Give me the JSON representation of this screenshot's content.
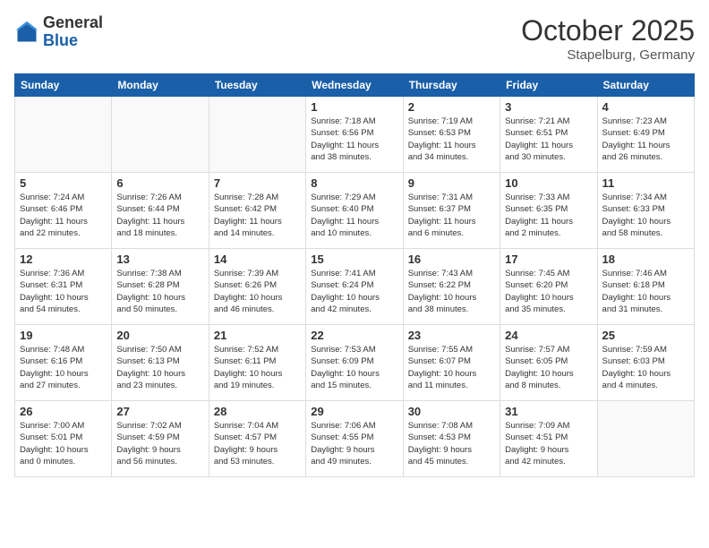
{
  "header": {
    "logo": {
      "general": "General",
      "blue": "Blue"
    },
    "month": "October 2025",
    "location": "Stapelburg, Germany"
  },
  "weekdays": [
    "Sunday",
    "Monday",
    "Tuesday",
    "Wednesday",
    "Thursday",
    "Friday",
    "Saturday"
  ],
  "weeks": [
    [
      {
        "day": "",
        "info": ""
      },
      {
        "day": "",
        "info": ""
      },
      {
        "day": "",
        "info": ""
      },
      {
        "day": "1",
        "info": "Sunrise: 7:18 AM\nSunset: 6:56 PM\nDaylight: 11 hours\nand 38 minutes."
      },
      {
        "day": "2",
        "info": "Sunrise: 7:19 AM\nSunset: 6:53 PM\nDaylight: 11 hours\nand 34 minutes."
      },
      {
        "day": "3",
        "info": "Sunrise: 7:21 AM\nSunset: 6:51 PM\nDaylight: 11 hours\nand 30 minutes."
      },
      {
        "day": "4",
        "info": "Sunrise: 7:23 AM\nSunset: 6:49 PM\nDaylight: 11 hours\nand 26 minutes."
      }
    ],
    [
      {
        "day": "5",
        "info": "Sunrise: 7:24 AM\nSunset: 6:46 PM\nDaylight: 11 hours\nand 22 minutes."
      },
      {
        "day": "6",
        "info": "Sunrise: 7:26 AM\nSunset: 6:44 PM\nDaylight: 11 hours\nand 18 minutes."
      },
      {
        "day": "7",
        "info": "Sunrise: 7:28 AM\nSunset: 6:42 PM\nDaylight: 11 hours\nand 14 minutes."
      },
      {
        "day": "8",
        "info": "Sunrise: 7:29 AM\nSunset: 6:40 PM\nDaylight: 11 hours\nand 10 minutes."
      },
      {
        "day": "9",
        "info": "Sunrise: 7:31 AM\nSunset: 6:37 PM\nDaylight: 11 hours\nand 6 minutes."
      },
      {
        "day": "10",
        "info": "Sunrise: 7:33 AM\nSunset: 6:35 PM\nDaylight: 11 hours\nand 2 minutes."
      },
      {
        "day": "11",
        "info": "Sunrise: 7:34 AM\nSunset: 6:33 PM\nDaylight: 10 hours\nand 58 minutes."
      }
    ],
    [
      {
        "day": "12",
        "info": "Sunrise: 7:36 AM\nSunset: 6:31 PM\nDaylight: 10 hours\nand 54 minutes."
      },
      {
        "day": "13",
        "info": "Sunrise: 7:38 AM\nSunset: 6:28 PM\nDaylight: 10 hours\nand 50 minutes."
      },
      {
        "day": "14",
        "info": "Sunrise: 7:39 AM\nSunset: 6:26 PM\nDaylight: 10 hours\nand 46 minutes."
      },
      {
        "day": "15",
        "info": "Sunrise: 7:41 AM\nSunset: 6:24 PM\nDaylight: 10 hours\nand 42 minutes."
      },
      {
        "day": "16",
        "info": "Sunrise: 7:43 AM\nSunset: 6:22 PM\nDaylight: 10 hours\nand 38 minutes."
      },
      {
        "day": "17",
        "info": "Sunrise: 7:45 AM\nSunset: 6:20 PM\nDaylight: 10 hours\nand 35 minutes."
      },
      {
        "day": "18",
        "info": "Sunrise: 7:46 AM\nSunset: 6:18 PM\nDaylight: 10 hours\nand 31 minutes."
      }
    ],
    [
      {
        "day": "19",
        "info": "Sunrise: 7:48 AM\nSunset: 6:16 PM\nDaylight: 10 hours\nand 27 minutes."
      },
      {
        "day": "20",
        "info": "Sunrise: 7:50 AM\nSunset: 6:13 PM\nDaylight: 10 hours\nand 23 minutes."
      },
      {
        "day": "21",
        "info": "Sunrise: 7:52 AM\nSunset: 6:11 PM\nDaylight: 10 hours\nand 19 minutes."
      },
      {
        "day": "22",
        "info": "Sunrise: 7:53 AM\nSunset: 6:09 PM\nDaylight: 10 hours\nand 15 minutes."
      },
      {
        "day": "23",
        "info": "Sunrise: 7:55 AM\nSunset: 6:07 PM\nDaylight: 10 hours\nand 11 minutes."
      },
      {
        "day": "24",
        "info": "Sunrise: 7:57 AM\nSunset: 6:05 PM\nDaylight: 10 hours\nand 8 minutes."
      },
      {
        "day": "25",
        "info": "Sunrise: 7:59 AM\nSunset: 6:03 PM\nDaylight: 10 hours\nand 4 minutes."
      }
    ],
    [
      {
        "day": "26",
        "info": "Sunrise: 7:00 AM\nSunset: 5:01 PM\nDaylight: 10 hours\nand 0 minutes."
      },
      {
        "day": "27",
        "info": "Sunrise: 7:02 AM\nSunset: 4:59 PM\nDaylight: 9 hours\nand 56 minutes."
      },
      {
        "day": "28",
        "info": "Sunrise: 7:04 AM\nSunset: 4:57 PM\nDaylight: 9 hours\nand 53 minutes."
      },
      {
        "day": "29",
        "info": "Sunrise: 7:06 AM\nSunset: 4:55 PM\nDaylight: 9 hours\nand 49 minutes."
      },
      {
        "day": "30",
        "info": "Sunrise: 7:08 AM\nSunset: 4:53 PM\nDaylight: 9 hours\nand 45 minutes."
      },
      {
        "day": "31",
        "info": "Sunrise: 7:09 AM\nSunset: 4:51 PM\nDaylight: 9 hours\nand 42 minutes."
      },
      {
        "day": "",
        "info": ""
      }
    ]
  ]
}
